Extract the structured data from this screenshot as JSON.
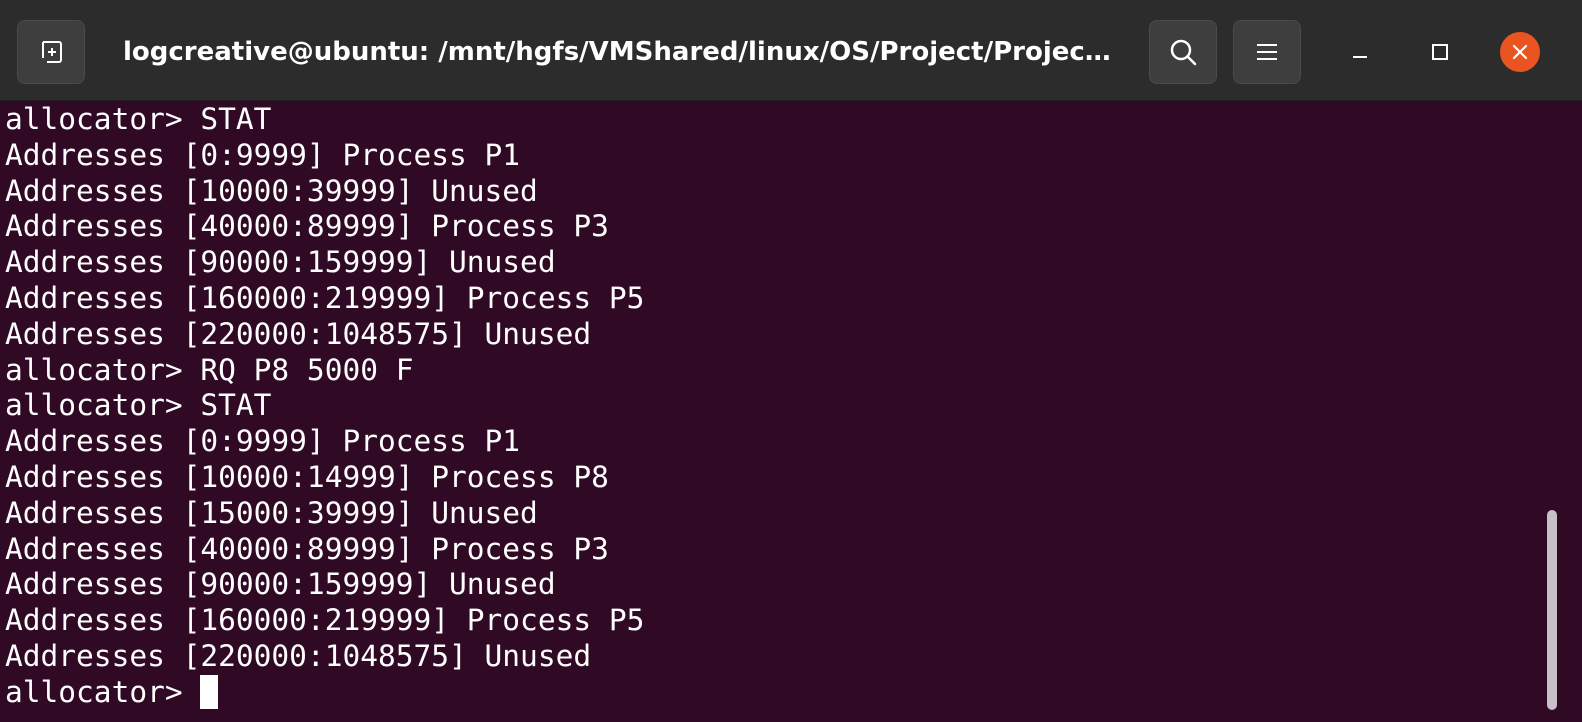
{
  "window": {
    "title": "logcreative@ubuntu: /mnt/hgfs/VMShared/linux/OS/Project/Projec…",
    "new_tab_icon": "new-tab-icon",
    "search_icon": "search-icon",
    "menu_icon": "hamburger-menu-icon",
    "minimize_icon": "minimize-icon",
    "maximize_icon": "maximize-icon",
    "close_icon": "close-icon",
    "accent_color": "#e95420",
    "background_color": "#300a24"
  },
  "terminal": {
    "lines": [
      "allocator> STAT",
      "Addresses [0:9999] Process P1",
      "Addresses [10000:39999] Unused",
      "Addresses [40000:89999] Process P3",
      "Addresses [90000:159999] Unused",
      "Addresses [160000:219999] Process P5",
      "Addresses [220000:1048575] Unused",
      "allocator> RQ P8 5000 F",
      "allocator> STAT",
      "Addresses [0:9999] Process P1",
      "Addresses [10000:14999] Process P8",
      "Addresses [15000:39999] Unused",
      "Addresses [40000:89999] Process P3",
      "Addresses [90000:159999] Unused",
      "Addresses [160000:219999] Process P5",
      "Addresses [220000:1048575] Unused"
    ],
    "prompt": "allocator> "
  }
}
